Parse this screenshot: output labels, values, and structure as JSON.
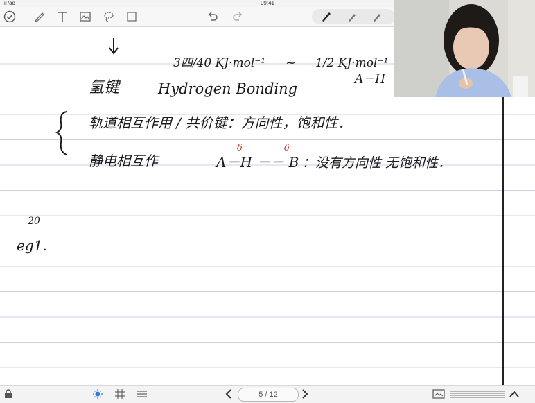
{
  "status": {
    "left": "iPad",
    "time": "09:41"
  },
  "toolbar": {
    "tools": [
      "done-icon",
      "pen-icon",
      "text-icon",
      "image-icon",
      "lasso-icon",
      "undo-icon",
      "redo-icon"
    ],
    "pens": [
      "highlighter-icon",
      "pen-icon",
      "marker-icon"
    ]
  },
  "notes": {
    "line1_left": "3四/40 KJ·mol⁻¹",
    "line1_sep": "~",
    "line1_right": "1/2 KJ·mol⁻¹",
    "line1_far": "A－H",
    "title_cn": "氢键",
    "title_en": "Hydrogen Bonding",
    "row1": "轨道相互作用 / 共价键：方向性，饱和性．",
    "row2_left": "静电相互作",
    "row2_mid": "A－H －－ B",
    "row2_right": "：没有方向性 无饱和性．",
    "delta_plus": "δ⁺",
    "delta_minus": "δ⁻",
    "side_num": "20",
    "side_eg": "eg1."
  },
  "bottom": {
    "page_label": "5 / 12"
  },
  "colors": {
    "ink": "#1a1a1a",
    "red_ink": "#c0392b",
    "rule": "#c9d2e6"
  }
}
